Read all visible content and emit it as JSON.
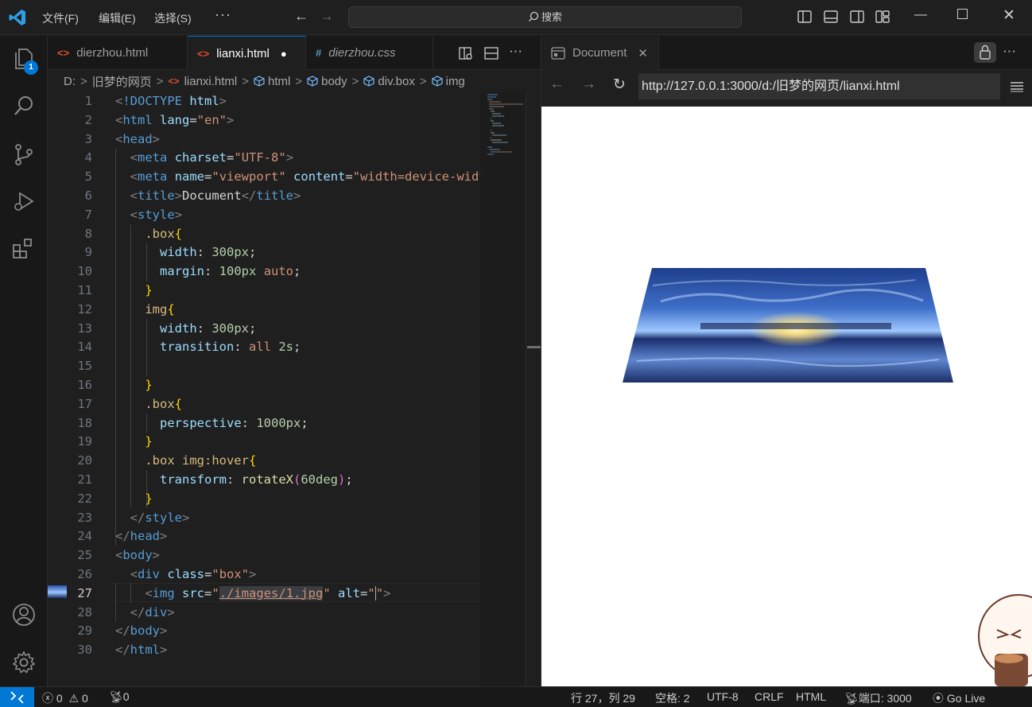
{
  "menu": {
    "file": "文件(F)",
    "edit": "编辑(E)",
    "select": "选择(S)",
    "more": "···"
  },
  "search": {
    "label": "搜索"
  },
  "activity": {
    "explorer_badge": "1"
  },
  "tabs": [
    {
      "icon": "<>",
      "label": "dierzhou.html"
    },
    {
      "icon": "<>",
      "label": "lianxi.html",
      "dirty": "●"
    },
    {
      "icon": "#",
      "label": "dierzhou.css"
    }
  ],
  "breadcrumb": [
    "D:",
    "旧梦的网页",
    "lianxi.html",
    "html",
    "body",
    "div.box",
    "img"
  ],
  "code": {
    "line_numbers": [
      "1",
      "2",
      "3",
      "4",
      "5",
      "6",
      "7",
      "8",
      "9",
      "10",
      "11",
      "12",
      "13",
      "14",
      "15",
      "16",
      "17",
      "18",
      "19",
      "20",
      "21",
      "22",
      "23",
      "24",
      "25",
      "26",
      "27",
      "28",
      "29",
      "30"
    ],
    "current_line": "27"
  },
  "preview": {
    "tab_label": "Document",
    "url": "http://127.0.0.1:3000/d:/旧梦的网页/lianxi.html"
  },
  "status": {
    "errors": "0",
    "warnings": "0",
    "ports": "0",
    "position": "行 27，列 29",
    "spaces": "空格: 2",
    "encoding": "UTF-8",
    "eol": "CRLF",
    "language": "HTML",
    "port": "端口: 3000",
    "golive": "Go Live"
  },
  "colors": {
    "accent": "#0078d4",
    "editor_bg": "#1f1f1f",
    "tag": "#569cd6",
    "attr": "#9cdcfe",
    "string": "#ce9178"
  }
}
